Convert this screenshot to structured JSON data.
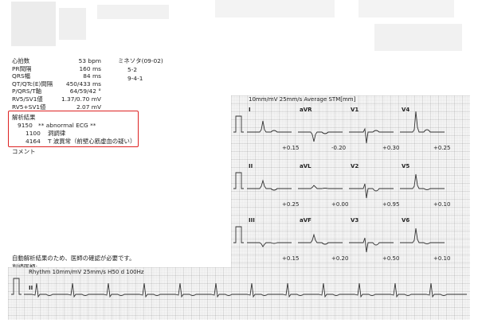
{
  "measurements": [
    {
      "label": "心拍数",
      "value": "53 bpm"
    },
    {
      "label": "PR間隔",
      "value": "160 ms"
    },
    {
      "label": "QRS幅",
      "value": "84 ms"
    },
    {
      "label": "QT/QTc(E)間隔",
      "value": "450/433 ms"
    },
    {
      "label": "P/QRS/T軸",
      "value": "64/59/42 °"
    },
    {
      "label": "RV5/SV1値",
      "value": "1.37/0.70 mV"
    },
    {
      "label": "RV5+SV1値",
      "value": "2.07 mV"
    }
  ],
  "minnesota": {
    "title": "ミネソタ(09-02)",
    "codes": [
      "5-2",
      "9-4-1"
    ]
  },
  "analysis": {
    "title": "解析結果",
    "entries": [
      {
        "code": "9150",
        "text": "** abnormal ECG **"
      },
      {
        "code": "1100",
        "text": "洞調律"
      },
      {
        "code": "4164",
        "text": "T 波異常（前壁心筋虚血の疑い）"
      }
    ],
    "highlight_color": "#d22222"
  },
  "comment_label": "コメント",
  "footer": {
    "note": "自動解析結果のため、医師の確認が必要です。",
    "doctor_label": "判読医師:"
  },
  "ecg": {
    "header": "10mm/mV  25mm/s  Average STM[mm]",
    "leads": [
      {
        "name": "I",
        "st": "+0.15",
        "shape": "posTupright"
      },
      {
        "name": "aVR",
        "st": "-0.20",
        "shape": "neg"
      },
      {
        "name": "V1",
        "st": "+0.30",
        "shape": "rS"
      },
      {
        "name": "V4",
        "st": "+0.25",
        "shape": "tallR"
      },
      {
        "name": "II",
        "st": "+0.25",
        "shape": "negT"
      },
      {
        "name": "aVL",
        "st": "+0.00",
        "shape": "small"
      },
      {
        "name": "V2",
        "st": "+0.95",
        "shape": "rSinv"
      },
      {
        "name": "V5",
        "st": "+0.10",
        "shape": "tallRinvT"
      },
      {
        "name": "III",
        "st": "+0.15",
        "shape": "smallNeg"
      },
      {
        "name": "aVF",
        "st": "+0.20",
        "shape": "negT"
      },
      {
        "name": "V3",
        "st": "+0.50",
        "shape": "rSinv"
      },
      {
        "name": "V6",
        "st": "+0.10",
        "shape": "tallRinvT"
      }
    ],
    "rhythm": {
      "header": "Rhythm 10mm/mV  25mm/s  H50 d 100Hz",
      "lead": "II",
      "beats": 12
    }
  }
}
